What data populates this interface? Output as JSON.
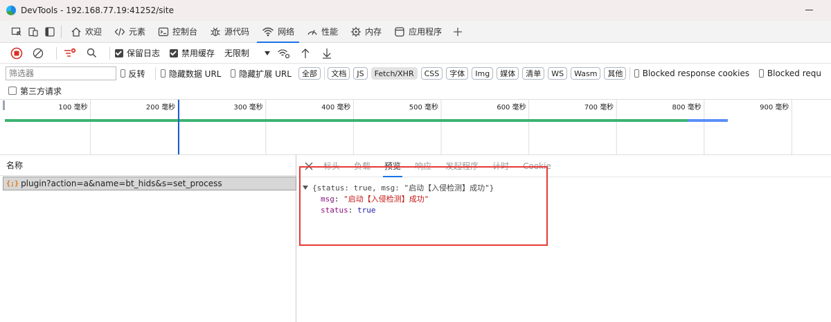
{
  "window": {
    "title": "DevTools - 192.168.77.19:41252/site"
  },
  "tabs": [
    {
      "label": "欢迎",
      "icon": "home-icon"
    },
    {
      "label": "元素",
      "icon": "code-icon"
    },
    {
      "label": "控制台",
      "icon": "console-icon"
    },
    {
      "label": "源代码",
      "icon": "bug-icon"
    },
    {
      "label": "网络",
      "icon": "wifi-icon",
      "active": true
    },
    {
      "label": "性能",
      "icon": "performance-icon"
    },
    {
      "label": "内存",
      "icon": "memory-icon"
    },
    {
      "label": "应用程序",
      "icon": "application-icon"
    }
  ],
  "toolbar": {
    "preserve_log": {
      "label": "保留日志",
      "checked": true
    },
    "disable_cache": {
      "label": "禁用缓存",
      "checked": true
    },
    "throttle": "无限制"
  },
  "filter": {
    "placeholder": "筛选器",
    "invert": "反转",
    "hide_data_urls": "隐藏数据 URL",
    "hide_extension_urls": "隐藏扩展 URL",
    "chips": [
      "全部",
      "文档",
      "JS",
      "Fetch/XHR",
      "CSS",
      "字体",
      "Img",
      "媒体",
      "清单",
      "WS",
      "Wasm",
      "其他"
    ],
    "active_chip": "Fetch/XHR",
    "blocked_cookies": "Blocked response cookies",
    "blocked_requests": "Blocked requ",
    "third_party": "第三方请求"
  },
  "overview": {
    "unit": "毫秒",
    "ticks": [
      "100",
      "200",
      "300",
      "400",
      "500",
      "600",
      "700",
      "800",
      "900"
    ],
    "colors": {
      "waiting": "#3cb371",
      "download": "#5b8ff9",
      "marker": "#1a5dc8"
    }
  },
  "requests": {
    "header": "名称",
    "items": [
      {
        "name": "plugin?action=a&name=bt_hids&s=set_process",
        "icon": "{;}"
      }
    ]
  },
  "detail": {
    "tabs": [
      "标头",
      "负载",
      "预览",
      "响应",
      "发起程序",
      "计时",
      "Cookie"
    ],
    "active_tab": "预览",
    "preview": {
      "summary": "{status: true, msg: \"启动【入侵检测】成功\"}",
      "msg_key": "msg",
      "msg_value": "\"启动【入侵检测】成功\"",
      "status_key": "status",
      "status_value": "true"
    }
  },
  "colors": {
    "accent": "#1a73e8",
    "highlight": "#e53935",
    "record_stop": "#d93025"
  }
}
